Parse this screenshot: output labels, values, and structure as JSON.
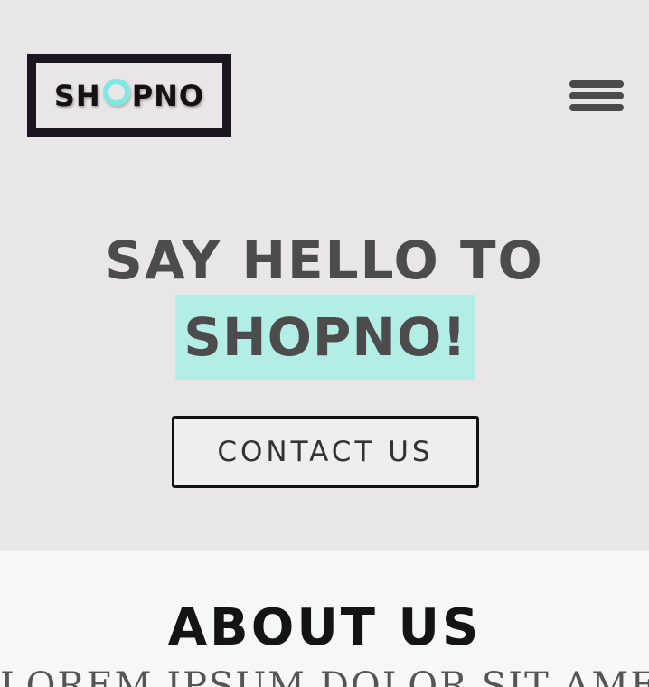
{
  "header": {
    "logo": {
      "prefix": "SH",
      "o_letter": "O",
      "suffix": "PNO",
      "accent_color": "#7fe8e0"
    },
    "menu_icon": "hamburger-menu-icon"
  },
  "hero": {
    "line1": "SAY HELLO TO",
    "line2": "SHOPNO!",
    "highlight_color": "#b2ede6",
    "contact_label": "CONTACT US"
  },
  "about": {
    "title": "ABOUT US",
    "subtitle": "LOREM IPSUM DOLOR SIT AMET"
  }
}
